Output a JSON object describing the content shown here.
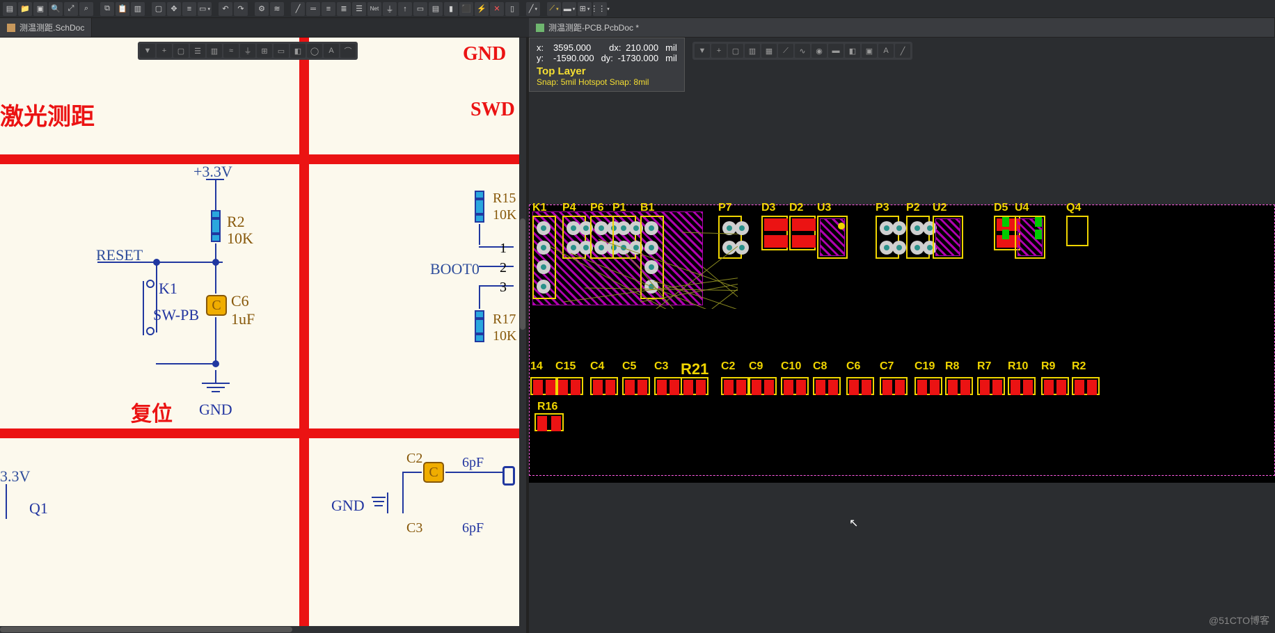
{
  "tabs": {
    "schematic": {
      "label": "测温测距.SchDoc",
      "icon_name": "schematic-icon"
    },
    "pcb": {
      "label": "测温测距-PCB.PcbDoc *",
      "icon_name": "pcb-icon"
    }
  },
  "heads_up": {
    "x_label": "x:",
    "y_label": "y:",
    "dx_label": "dx:",
    "dy_label": "dy:",
    "x": "3595.000",
    "y": "-1590.000",
    "dx": "210.000",
    "dy": "-1730.000",
    "unit": "mil",
    "layer": "Top Layer",
    "snap": "Snap: 5mil Hotspot Snap: 8mil"
  },
  "schematic": {
    "blocks": {
      "laser": "激光测距",
      "reset_title": "复位",
      "gnd_top": "GND",
      "swd": "SWD"
    },
    "nets": {
      "v33": "+3.3V",
      "v33b": "3.3V",
      "reset": "RESET",
      "boot0": "BOOT0",
      "gnd": "GND",
      "gnd2": "GND",
      "q1": "Q1"
    },
    "pins": {
      "p1": "1",
      "p2": "2",
      "p3": "3"
    },
    "components": {
      "r2": {
        "ref": "R2",
        "val": "10K"
      },
      "r15": {
        "ref": "R15",
        "val": "10K"
      },
      "r17": {
        "ref": "R17",
        "val": "10K"
      },
      "c6": {
        "ref": "C6",
        "val": "1uF"
      },
      "c2": {
        "ref": "C2",
        "val": "6pF"
      },
      "c3": {
        "ref": "C3",
        "val": "6pF"
      },
      "k1": {
        "ref": "K1",
        "val": "SW-PB"
      },
      "cap_letter": "C"
    }
  },
  "pcb": {
    "row1": [
      "K1",
      "P4",
      "P6",
      "P1",
      "B1",
      "P7",
      "D3",
      "D2",
      "U3",
      "P3",
      "P2",
      "U2",
      "D5",
      "U4",
      "Q4"
    ],
    "row2": [
      "14",
      "C15",
      "C4",
      "C5",
      "C3",
      "R21",
      "C2",
      "C9",
      "C10",
      "C8",
      "C6",
      "C7",
      "C19",
      "R8",
      "R7",
      "R10",
      "R9",
      "R2"
    ],
    "r16": "R16"
  },
  "watermark": "@51CTO博客",
  "colors": {
    "red": "#eb1313",
    "yellow": "#f0d500",
    "magenta": "#b000b0",
    "blue": "#2138a0",
    "bg_sch": "#fcf9ed"
  }
}
